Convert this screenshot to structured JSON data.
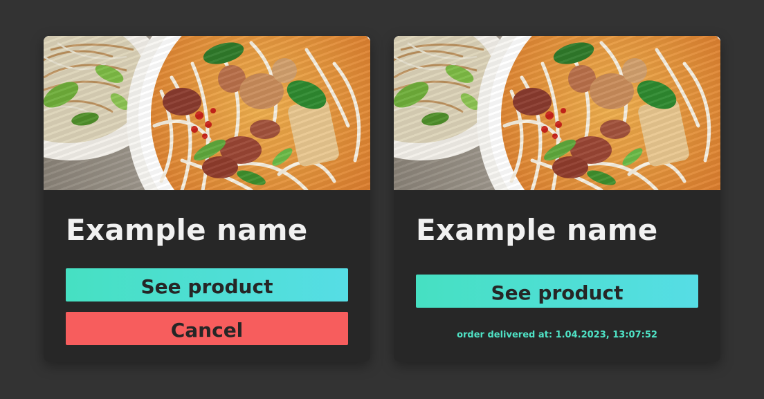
{
  "cards": [
    {
      "title": "Example name",
      "primary_button": "See product",
      "secondary_button": "Cancel"
    },
    {
      "title": "Example name",
      "primary_button": "See product",
      "status_text": "order delivered at: 1.04.2023, 13:07:52"
    }
  ],
  "colors": {
    "background": "#333333",
    "card": "#272727",
    "primary_gradient_start": "#46e0c2",
    "primary_gradient_end": "#56dde5",
    "danger": "#f75d5d",
    "status_text": "#4fe3c6"
  }
}
